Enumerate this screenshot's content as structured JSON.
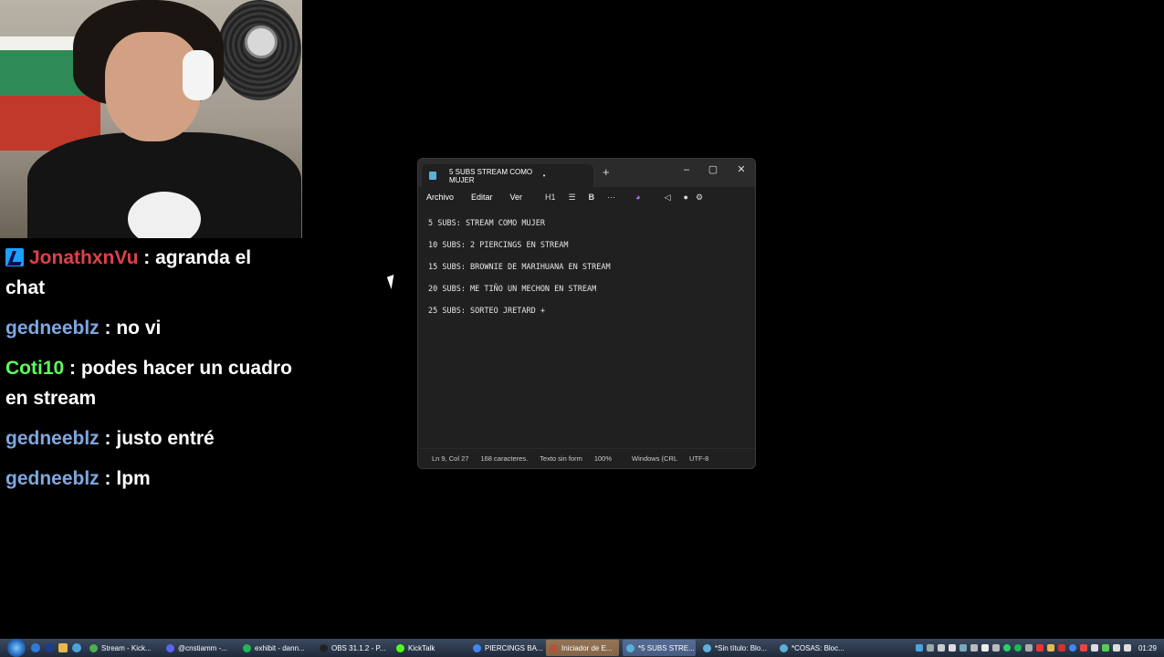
{
  "chat": {
    "messages": [
      {
        "user": "JonathxnVu",
        "color": "#e0404a",
        "badge": true,
        "text": "agranda el chat"
      },
      {
        "user": "gedneeblz",
        "color": "#7fa7e0",
        "badge": false,
        "text": "no vi"
      },
      {
        "user": "Coti10",
        "color": "#5cff5c",
        "badge": false,
        "text": "podes hacer un cuadro en stream"
      },
      {
        "user": "gedneeblz",
        "color": "#7fa7e0",
        "badge": false,
        "text": "justo entré"
      },
      {
        "user": "gedneeblz",
        "color": "#7fa7e0",
        "badge": false,
        "text": "lpm"
      }
    ]
  },
  "notepad": {
    "tab_title": "5 SUBS STREAM COMO MUJER",
    "tab_close": "•",
    "new_tab": "+",
    "controls": {
      "minimize": "–",
      "maximize": "▢",
      "close": "✕"
    },
    "menu": [
      "Archivo",
      "Editar",
      "Ver"
    ],
    "toolbar": {
      "heading": "H1",
      "list": "☰",
      "bold": "B",
      "more": "···",
      "copilot": "◕",
      "share": "◁",
      "account": "●",
      "settings": "⚙"
    },
    "lines": [
      "5 SUBS: STREAM COMO MUJER",
      "10 SUBS: 2 PIERCINGS EN STREAM",
      "15 SUBS: BROWNIE DE MARIHUANA EN STREAM",
      "20 SUBS: ME TIÑO UN MECHON EN STREAM",
      "25 SUBS: SORTEO JRETARD +"
    ],
    "status": {
      "position": "Ln 9, Col 27",
      "chars": "168 caracteres.",
      "format": "Texto sin form",
      "zoom": "100%",
      "line_ending": "Windows (CRL",
      "encoding": "UTF-8"
    }
  },
  "taskbar": {
    "items": [
      {
        "label": "Stream - Kick...",
        "color": "#4caf50",
        "state": "normal"
      },
      {
        "label": "@cnstiamm -...",
        "color": "#5865f2",
        "state": "normal"
      },
      {
        "label": "exhibit - dann...",
        "color": "#1db954",
        "state": "normal"
      },
      {
        "label": "OBS 31.1.2 - P...",
        "color": "#222222",
        "state": "normal"
      },
      {
        "label": "KickTalk",
        "color": "#53fc18",
        "state": "normal"
      },
      {
        "label": "PIERCINGS BA...",
        "color": "#4285f4",
        "state": "normal"
      },
      {
        "label": "Iniciador de E...",
        "color": "#b5523b",
        "state": "active"
      },
      {
        "label": "*5 SUBS STRE...",
        "color": "#5ab0d8",
        "state": "current"
      },
      {
        "label": "*Sin título: Blo...",
        "color": "#5ab0d8",
        "state": "normal"
      },
      {
        "label": "*COSAS: Bloc...",
        "color": "#5ab0d8",
        "state": "normal"
      }
    ],
    "clock": "01:29"
  }
}
